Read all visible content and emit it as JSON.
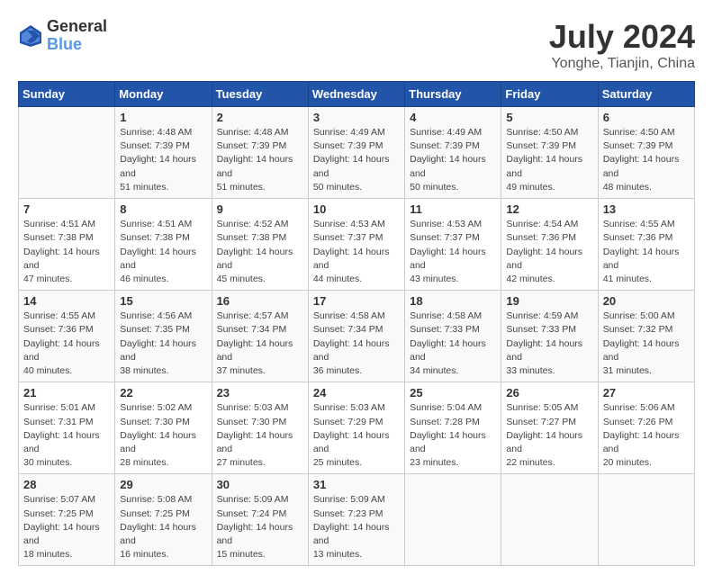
{
  "logo": {
    "line1": "General",
    "line2": "Blue"
  },
  "title": "July 2024",
  "location": "Yonghe, Tianjin, China",
  "headers": [
    "Sunday",
    "Monday",
    "Tuesday",
    "Wednesday",
    "Thursday",
    "Friday",
    "Saturday"
  ],
  "weeks": [
    [
      {
        "day": "",
        "sunrise": "",
        "sunset": "",
        "daylight": ""
      },
      {
        "day": "1",
        "sunrise": "Sunrise: 4:48 AM",
        "sunset": "Sunset: 7:39 PM",
        "daylight": "Daylight: 14 hours and 51 minutes."
      },
      {
        "day": "2",
        "sunrise": "Sunrise: 4:48 AM",
        "sunset": "Sunset: 7:39 PM",
        "daylight": "Daylight: 14 hours and 51 minutes."
      },
      {
        "day": "3",
        "sunrise": "Sunrise: 4:49 AM",
        "sunset": "Sunset: 7:39 PM",
        "daylight": "Daylight: 14 hours and 50 minutes."
      },
      {
        "day": "4",
        "sunrise": "Sunrise: 4:49 AM",
        "sunset": "Sunset: 7:39 PM",
        "daylight": "Daylight: 14 hours and 50 minutes."
      },
      {
        "day": "5",
        "sunrise": "Sunrise: 4:50 AM",
        "sunset": "Sunset: 7:39 PM",
        "daylight": "Daylight: 14 hours and 49 minutes."
      },
      {
        "day": "6",
        "sunrise": "Sunrise: 4:50 AM",
        "sunset": "Sunset: 7:39 PM",
        "daylight": "Daylight: 14 hours and 48 minutes."
      }
    ],
    [
      {
        "day": "7",
        "sunrise": "Sunrise: 4:51 AM",
        "sunset": "Sunset: 7:38 PM",
        "daylight": "Daylight: 14 hours and 47 minutes."
      },
      {
        "day": "8",
        "sunrise": "Sunrise: 4:51 AM",
        "sunset": "Sunset: 7:38 PM",
        "daylight": "Daylight: 14 hours and 46 minutes."
      },
      {
        "day": "9",
        "sunrise": "Sunrise: 4:52 AM",
        "sunset": "Sunset: 7:38 PM",
        "daylight": "Daylight: 14 hours and 45 minutes."
      },
      {
        "day": "10",
        "sunrise": "Sunrise: 4:53 AM",
        "sunset": "Sunset: 7:37 PM",
        "daylight": "Daylight: 14 hours and 44 minutes."
      },
      {
        "day": "11",
        "sunrise": "Sunrise: 4:53 AM",
        "sunset": "Sunset: 7:37 PM",
        "daylight": "Daylight: 14 hours and 43 minutes."
      },
      {
        "day": "12",
        "sunrise": "Sunrise: 4:54 AM",
        "sunset": "Sunset: 7:36 PM",
        "daylight": "Daylight: 14 hours and 42 minutes."
      },
      {
        "day": "13",
        "sunrise": "Sunrise: 4:55 AM",
        "sunset": "Sunset: 7:36 PM",
        "daylight": "Daylight: 14 hours and 41 minutes."
      }
    ],
    [
      {
        "day": "14",
        "sunrise": "Sunrise: 4:55 AM",
        "sunset": "Sunset: 7:36 PM",
        "daylight": "Daylight: 14 hours and 40 minutes."
      },
      {
        "day": "15",
        "sunrise": "Sunrise: 4:56 AM",
        "sunset": "Sunset: 7:35 PM",
        "daylight": "Daylight: 14 hours and 38 minutes."
      },
      {
        "day": "16",
        "sunrise": "Sunrise: 4:57 AM",
        "sunset": "Sunset: 7:34 PM",
        "daylight": "Daylight: 14 hours and 37 minutes."
      },
      {
        "day": "17",
        "sunrise": "Sunrise: 4:58 AM",
        "sunset": "Sunset: 7:34 PM",
        "daylight": "Daylight: 14 hours and 36 minutes."
      },
      {
        "day": "18",
        "sunrise": "Sunrise: 4:58 AM",
        "sunset": "Sunset: 7:33 PM",
        "daylight": "Daylight: 14 hours and 34 minutes."
      },
      {
        "day": "19",
        "sunrise": "Sunrise: 4:59 AM",
        "sunset": "Sunset: 7:33 PM",
        "daylight": "Daylight: 14 hours and 33 minutes."
      },
      {
        "day": "20",
        "sunrise": "Sunrise: 5:00 AM",
        "sunset": "Sunset: 7:32 PM",
        "daylight": "Daylight: 14 hours and 31 minutes."
      }
    ],
    [
      {
        "day": "21",
        "sunrise": "Sunrise: 5:01 AM",
        "sunset": "Sunset: 7:31 PM",
        "daylight": "Daylight: 14 hours and 30 minutes."
      },
      {
        "day": "22",
        "sunrise": "Sunrise: 5:02 AM",
        "sunset": "Sunset: 7:30 PM",
        "daylight": "Daylight: 14 hours and 28 minutes."
      },
      {
        "day": "23",
        "sunrise": "Sunrise: 5:03 AM",
        "sunset": "Sunset: 7:30 PM",
        "daylight": "Daylight: 14 hours and 27 minutes."
      },
      {
        "day": "24",
        "sunrise": "Sunrise: 5:03 AM",
        "sunset": "Sunset: 7:29 PM",
        "daylight": "Daylight: 14 hours and 25 minutes."
      },
      {
        "day": "25",
        "sunrise": "Sunrise: 5:04 AM",
        "sunset": "Sunset: 7:28 PM",
        "daylight": "Daylight: 14 hours and 23 minutes."
      },
      {
        "day": "26",
        "sunrise": "Sunrise: 5:05 AM",
        "sunset": "Sunset: 7:27 PM",
        "daylight": "Daylight: 14 hours and 22 minutes."
      },
      {
        "day": "27",
        "sunrise": "Sunrise: 5:06 AM",
        "sunset": "Sunset: 7:26 PM",
        "daylight": "Daylight: 14 hours and 20 minutes."
      }
    ],
    [
      {
        "day": "28",
        "sunrise": "Sunrise: 5:07 AM",
        "sunset": "Sunset: 7:25 PM",
        "daylight": "Daylight: 14 hours and 18 minutes."
      },
      {
        "day": "29",
        "sunrise": "Sunrise: 5:08 AM",
        "sunset": "Sunset: 7:25 PM",
        "daylight": "Daylight: 14 hours and 16 minutes."
      },
      {
        "day": "30",
        "sunrise": "Sunrise: 5:09 AM",
        "sunset": "Sunset: 7:24 PM",
        "daylight": "Daylight: 14 hours and 15 minutes."
      },
      {
        "day": "31",
        "sunrise": "Sunrise: 5:09 AM",
        "sunset": "Sunset: 7:23 PM",
        "daylight": "Daylight: 14 hours and 13 minutes."
      },
      {
        "day": "",
        "sunrise": "",
        "sunset": "",
        "daylight": ""
      },
      {
        "day": "",
        "sunrise": "",
        "sunset": "",
        "daylight": ""
      },
      {
        "day": "",
        "sunrise": "",
        "sunset": "",
        "daylight": ""
      }
    ]
  ]
}
